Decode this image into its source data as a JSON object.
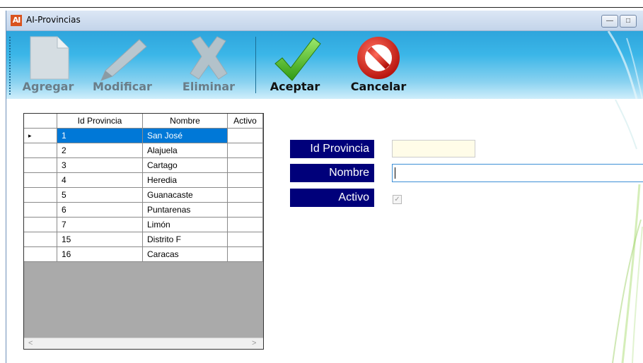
{
  "window": {
    "icon_text": "AI",
    "title": "AI-Provincias",
    "minimize_glyph": "—",
    "maximize_glyph": "□"
  },
  "toolbar": {
    "buttons": [
      {
        "label": "Agregar",
        "icon": "new-document-icon",
        "enabled": false
      },
      {
        "label": "Modificar",
        "icon": "pencil-icon",
        "enabled": false
      },
      {
        "label": "Eliminar",
        "icon": "delete-x-icon",
        "enabled": false
      },
      {
        "label": "Aceptar",
        "icon": "checkmark-icon",
        "enabled": true
      },
      {
        "label": "Cancelar",
        "icon": "cancel-icon",
        "enabled": true
      }
    ]
  },
  "grid": {
    "columns": [
      "Id Provincia",
      "Nombre",
      "Activo"
    ],
    "rows": [
      {
        "id": "1",
        "nombre": "San José",
        "activo": ""
      },
      {
        "id": "2",
        "nombre": "Alajuela",
        "activo": ""
      },
      {
        "id": "3",
        "nombre": "Cartago",
        "activo": ""
      },
      {
        "id": "4",
        "nombre": "Heredia",
        "activo": ""
      },
      {
        "id": "5",
        "nombre": "Guanacaste",
        "activo": ""
      },
      {
        "id": "6",
        "nombre": "Puntarenas",
        "activo": ""
      },
      {
        "id": "7",
        "nombre": "Limón",
        "activo": ""
      },
      {
        "id": "15",
        "nombre": "Distrito F",
        "activo": ""
      },
      {
        "id": "16",
        "nombre": "Caracas",
        "activo": ""
      }
    ],
    "selected_row": 0,
    "row_marker": "▸",
    "scroll_left": "<",
    "scroll_right": ">"
  },
  "form": {
    "id_label": "Id Provincia",
    "id_value": "",
    "nombre_label": "Nombre",
    "nombre_value": "",
    "activo_label": "Activo",
    "activo_checked": true
  },
  "colors": {
    "label_bg": "#00007a",
    "selection": "#0078d7",
    "toolbar_top": "#2ea5dc"
  }
}
